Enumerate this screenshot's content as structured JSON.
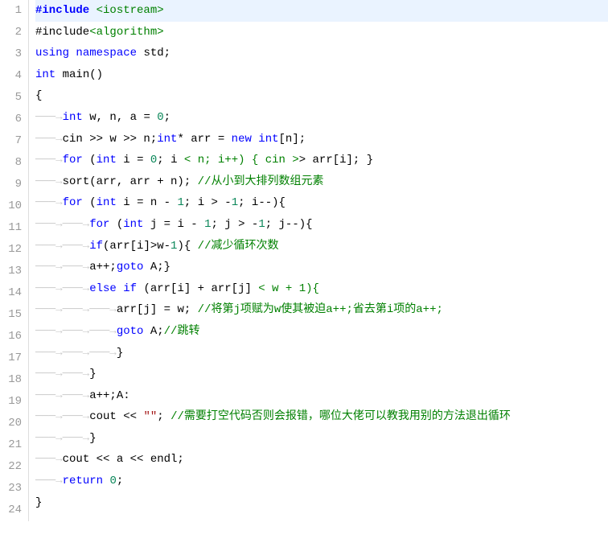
{
  "lines": [
    {
      "num": 1,
      "highlight": true,
      "tokens": [
        {
          "t": "#include ",
          "c": "pre"
        },
        {
          "t": "<iostream>",
          "c": "inc2"
        }
      ]
    },
    {
      "num": 2,
      "tokens": [
        {
          "t": "#include",
          "c": "id"
        },
        {
          "t": "<algorithm>",
          "c": "inc2"
        }
      ]
    },
    {
      "num": 3,
      "tokens": [
        {
          "t": "using",
          "c": "kw"
        },
        {
          "t": " ",
          "c": "id"
        },
        {
          "t": "namespace",
          "c": "kw"
        },
        {
          "t": " std;",
          "c": "id"
        }
      ]
    },
    {
      "num": 4,
      "tokens": [
        {
          "t": "int",
          "c": "kw"
        },
        {
          "t": " main()",
          "c": "id"
        }
      ]
    },
    {
      "num": 5,
      "tokens": [
        {
          "t": "{",
          "c": "id"
        }
      ]
    },
    {
      "num": 6,
      "tokens": [
        {
          "t": "───→",
          "c": "ws"
        },
        {
          "t": "int",
          "c": "kw"
        },
        {
          "t": " w, n, a = ",
          "c": "id"
        },
        {
          "t": "0",
          "c": "num"
        },
        {
          "t": ";",
          "c": "id"
        }
      ]
    },
    {
      "num": 7,
      "tokens": [
        {
          "t": "───→",
          "c": "ws"
        },
        {
          "t": "cin >> w >> n;",
          "c": "id"
        },
        {
          "t": "int",
          "c": "kw"
        },
        {
          "t": "* arr = ",
          "c": "id"
        },
        {
          "t": "new",
          "c": "kw"
        },
        {
          "t": " ",
          "c": "id"
        },
        {
          "t": "int",
          "c": "kw"
        },
        {
          "t": "[n];",
          "c": "id"
        }
      ]
    },
    {
      "num": 8,
      "tokens": [
        {
          "t": "───→",
          "c": "ws"
        },
        {
          "t": "for",
          "c": "kw"
        },
        {
          "t": " (",
          "c": "id"
        },
        {
          "t": "int",
          "c": "kw"
        },
        {
          "t": " i = ",
          "c": "id"
        },
        {
          "t": "0",
          "c": "num"
        },
        {
          "t": "; i ",
          "c": "id"
        },
        {
          "t": "< n; i++) { cin >",
          "c": "greenop"
        },
        {
          "t": "> arr[i]; }",
          "c": "id"
        }
      ]
    },
    {
      "num": 9,
      "tokens": [
        {
          "t": "───→",
          "c": "ws"
        },
        {
          "t": "sort(arr, arr + n); ",
          "c": "id"
        },
        {
          "t": "//从小到大排列数组元素",
          "c": "comm"
        }
      ]
    },
    {
      "num": 10,
      "tokens": [
        {
          "t": "───→",
          "c": "ws"
        },
        {
          "t": "for",
          "c": "kw"
        },
        {
          "t": " (",
          "c": "id"
        },
        {
          "t": "int",
          "c": "kw"
        },
        {
          "t": " i = n - ",
          "c": "id"
        },
        {
          "t": "1",
          "c": "num"
        },
        {
          "t": "; i > -",
          "c": "id"
        },
        {
          "t": "1",
          "c": "num"
        },
        {
          "t": "; i--){",
          "c": "id"
        }
      ]
    },
    {
      "num": 11,
      "tokens": [
        {
          "t": "───→───→",
          "c": "ws"
        },
        {
          "t": "for",
          "c": "kw"
        },
        {
          "t": " (",
          "c": "id"
        },
        {
          "t": "int",
          "c": "kw"
        },
        {
          "t": " j = i - ",
          "c": "id"
        },
        {
          "t": "1",
          "c": "num"
        },
        {
          "t": "; j > -",
          "c": "id"
        },
        {
          "t": "1",
          "c": "num"
        },
        {
          "t": "; j--){",
          "c": "id"
        }
      ]
    },
    {
      "num": 12,
      "tokens": [
        {
          "t": "───→───→",
          "c": "ws"
        },
        {
          "t": "if",
          "c": "kw"
        },
        {
          "t": "(arr[i]>w-",
          "c": "id"
        },
        {
          "t": "1",
          "c": "num"
        },
        {
          "t": "){ ",
          "c": "id"
        },
        {
          "t": "//减少循环次数",
          "c": "comm"
        }
      ]
    },
    {
      "num": 13,
      "tokens": [
        {
          "t": "───→───→",
          "c": "ws"
        },
        {
          "t": "a++;",
          "c": "id"
        },
        {
          "t": "goto",
          "c": "kw"
        },
        {
          "t": " A;}",
          "c": "id"
        }
      ]
    },
    {
      "num": 14,
      "tokens": [
        {
          "t": "───→───→",
          "c": "ws"
        },
        {
          "t": "else",
          "c": "kw"
        },
        {
          "t": " ",
          "c": "id"
        },
        {
          "t": "if",
          "c": "kw"
        },
        {
          "t": " (arr[i] + arr[j] ",
          "c": "id"
        },
        {
          "t": "< w + 1){",
          "c": "greenop"
        }
      ]
    },
    {
      "num": 15,
      "tokens": [
        {
          "t": "───→───→───→",
          "c": "ws"
        },
        {
          "t": "arr[j] = w; ",
          "c": "id"
        },
        {
          "t": "//将第j项赋为w使其被迫a++;省去第i项的a++;",
          "c": "comm"
        }
      ]
    },
    {
      "num": 16,
      "tokens": [
        {
          "t": "───→───→───→",
          "c": "ws"
        },
        {
          "t": "goto",
          "c": "kw"
        },
        {
          "t": " A;",
          "c": "id"
        },
        {
          "t": "//跳转",
          "c": "comm"
        }
      ]
    },
    {
      "num": 17,
      "tokens": [
        {
          "t": "───→───→───→",
          "c": "ws"
        },
        {
          "t": "}",
          "c": "id"
        }
      ]
    },
    {
      "num": 18,
      "tokens": [
        {
          "t": "───→───→",
          "c": "ws"
        },
        {
          "t": "}",
          "c": "id"
        }
      ]
    },
    {
      "num": 19,
      "tokens": [
        {
          "t": "───→───→",
          "c": "ws"
        },
        {
          "t": "a++;A:",
          "c": "id"
        }
      ]
    },
    {
      "num": 20,
      "tokens": [
        {
          "t": "───→───→",
          "c": "ws"
        },
        {
          "t": "cout << ",
          "c": "id"
        },
        {
          "t": "\"\"",
          "c": "str"
        },
        {
          "t": "; ",
          "c": "id"
        },
        {
          "t": "//需要打空代码否则会报错，哪位大佬可以教我用别的方法退出循环",
          "c": "comm"
        }
      ]
    },
    {
      "num": 21,
      "tokens": [
        {
          "t": "───→───→",
          "c": "ws"
        },
        {
          "t": "}",
          "c": "id"
        }
      ]
    },
    {
      "num": 22,
      "tokens": [
        {
          "t": "───→",
          "c": "ws"
        },
        {
          "t": "cout << a << endl;",
          "c": "id"
        }
      ]
    },
    {
      "num": 23,
      "tokens": [
        {
          "t": "───→",
          "c": "ws"
        },
        {
          "t": "return",
          "c": "kw"
        },
        {
          "t": " ",
          "c": "id"
        },
        {
          "t": "0",
          "c": "num"
        },
        {
          "t": ";",
          "c": "id"
        }
      ]
    },
    {
      "num": 24,
      "tokens": [
        {
          "t": "}",
          "c": "id"
        }
      ]
    }
  ]
}
